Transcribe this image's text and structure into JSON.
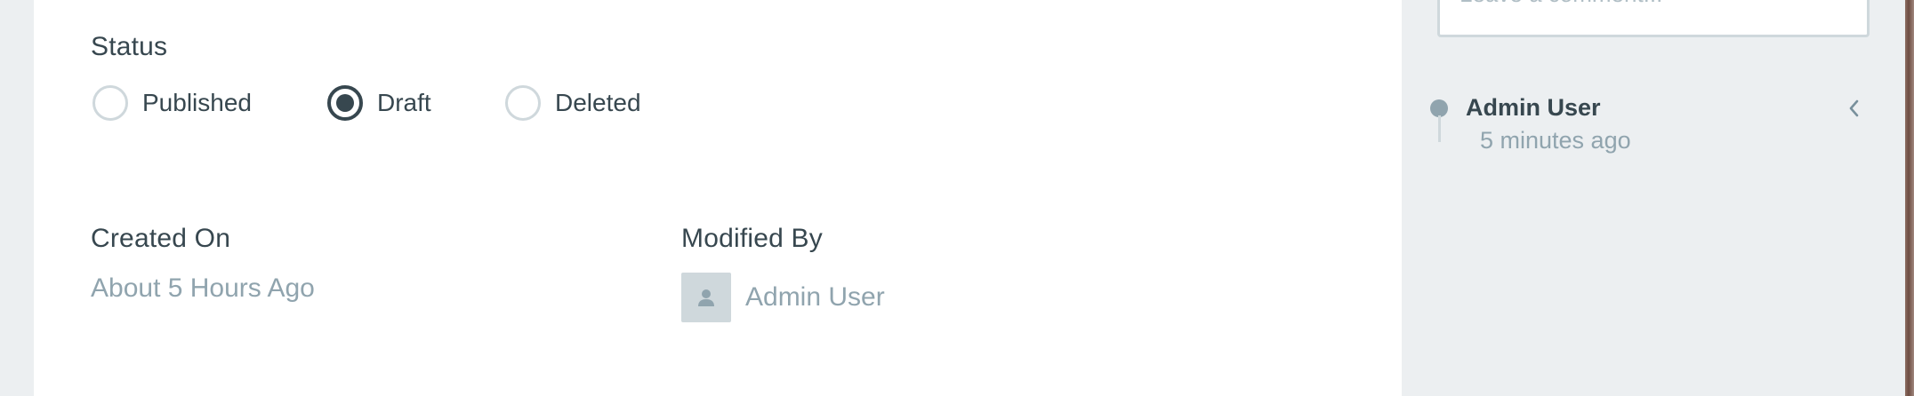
{
  "status": {
    "label": "Status",
    "options": [
      {
        "label": "Published",
        "checked": false
      },
      {
        "label": "Draft",
        "checked": true
      },
      {
        "label": "Deleted",
        "checked": false
      }
    ]
  },
  "created": {
    "label": "Created On",
    "value": "About 5 Hours Ago"
  },
  "modified": {
    "label": "Modified By",
    "user": "Admin User"
  },
  "sidebar": {
    "comment_placeholder": "Leave a comment...",
    "activity": {
      "user": "Admin User",
      "time": "5 minutes ago"
    }
  },
  "colors": {
    "text_primary": "#37474f",
    "text_muted": "#90a4ae",
    "border": "#cfd8dc",
    "background": "#eceff1",
    "panel": "#ffffff"
  },
  "icons": {
    "avatar": "user-silhouette-icon",
    "collapse": "chevron-left-icon"
  }
}
